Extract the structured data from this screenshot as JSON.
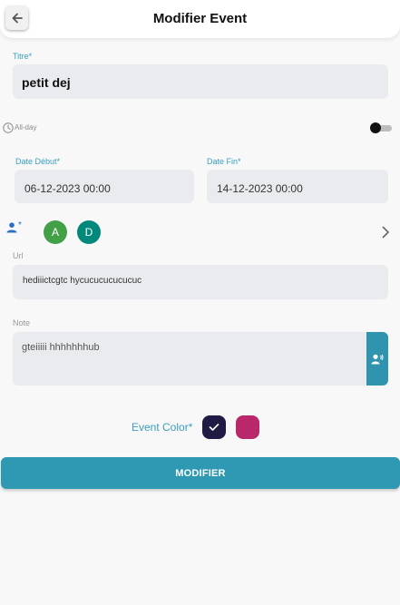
{
  "header": {
    "title": "Modifier Event"
  },
  "titre": {
    "label": "Titre*",
    "value": "petit dej"
  },
  "allday": {
    "label": "All-day",
    "enabled": false
  },
  "date_debut": {
    "label": "Date Début*",
    "value": "06-12-2023 00:00"
  },
  "date_fin": {
    "label": "Date Fin*",
    "value": "14-12-2023 00:00"
  },
  "participants": {
    "required_mark": "*",
    "avatars": [
      {
        "initial": "A",
        "color": "#43a047"
      },
      {
        "initial": "D",
        "color": "#00897b"
      }
    ]
  },
  "url": {
    "label": "Url",
    "value": "hediiictcgtc hycucucucucucuc"
  },
  "note": {
    "label": "Note",
    "value": "gteiiiii hhhhhhhub"
  },
  "event_color": {
    "label": "Event Color*",
    "options": [
      {
        "color": "#1f1b45",
        "selected": true
      },
      {
        "color": "#b8286a",
        "selected": false
      }
    ]
  },
  "submit": {
    "label": "MODIFIER"
  },
  "colors": {
    "accent": "#3194ae",
    "field_bg": "#e9ebee"
  }
}
